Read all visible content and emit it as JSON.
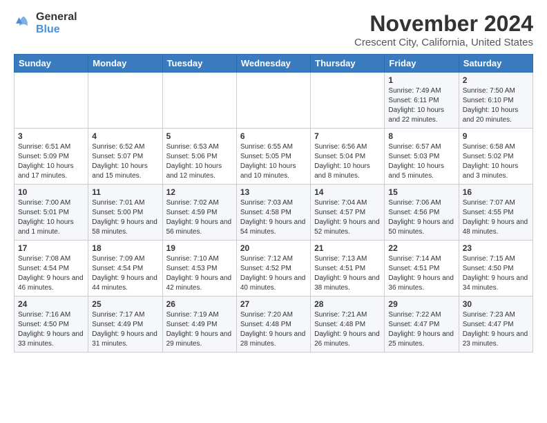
{
  "logo": {
    "line1": "General",
    "line2": "Blue"
  },
  "title": "November 2024",
  "subtitle": "Crescent City, California, United States",
  "days_of_week": [
    "Sunday",
    "Monday",
    "Tuesday",
    "Wednesday",
    "Thursday",
    "Friday",
    "Saturday"
  ],
  "weeks": [
    [
      {
        "day": "",
        "info": ""
      },
      {
        "day": "",
        "info": ""
      },
      {
        "day": "",
        "info": ""
      },
      {
        "day": "",
        "info": ""
      },
      {
        "day": "",
        "info": ""
      },
      {
        "day": "1",
        "info": "Sunrise: 7:49 AM\nSunset: 6:11 PM\nDaylight: 10 hours and 22 minutes."
      },
      {
        "day": "2",
        "info": "Sunrise: 7:50 AM\nSunset: 6:10 PM\nDaylight: 10 hours and 20 minutes."
      }
    ],
    [
      {
        "day": "3",
        "info": "Sunrise: 6:51 AM\nSunset: 5:09 PM\nDaylight: 10 hours and 17 minutes."
      },
      {
        "day": "4",
        "info": "Sunrise: 6:52 AM\nSunset: 5:07 PM\nDaylight: 10 hours and 15 minutes."
      },
      {
        "day": "5",
        "info": "Sunrise: 6:53 AM\nSunset: 5:06 PM\nDaylight: 10 hours and 12 minutes."
      },
      {
        "day": "6",
        "info": "Sunrise: 6:55 AM\nSunset: 5:05 PM\nDaylight: 10 hours and 10 minutes."
      },
      {
        "day": "7",
        "info": "Sunrise: 6:56 AM\nSunset: 5:04 PM\nDaylight: 10 hours and 8 minutes."
      },
      {
        "day": "8",
        "info": "Sunrise: 6:57 AM\nSunset: 5:03 PM\nDaylight: 10 hours and 5 minutes."
      },
      {
        "day": "9",
        "info": "Sunrise: 6:58 AM\nSunset: 5:02 PM\nDaylight: 10 hours and 3 minutes."
      }
    ],
    [
      {
        "day": "10",
        "info": "Sunrise: 7:00 AM\nSunset: 5:01 PM\nDaylight: 10 hours and 1 minute."
      },
      {
        "day": "11",
        "info": "Sunrise: 7:01 AM\nSunset: 5:00 PM\nDaylight: 9 hours and 58 minutes."
      },
      {
        "day": "12",
        "info": "Sunrise: 7:02 AM\nSunset: 4:59 PM\nDaylight: 9 hours and 56 minutes."
      },
      {
        "day": "13",
        "info": "Sunrise: 7:03 AM\nSunset: 4:58 PM\nDaylight: 9 hours and 54 minutes."
      },
      {
        "day": "14",
        "info": "Sunrise: 7:04 AM\nSunset: 4:57 PM\nDaylight: 9 hours and 52 minutes."
      },
      {
        "day": "15",
        "info": "Sunrise: 7:06 AM\nSunset: 4:56 PM\nDaylight: 9 hours and 50 minutes."
      },
      {
        "day": "16",
        "info": "Sunrise: 7:07 AM\nSunset: 4:55 PM\nDaylight: 9 hours and 48 minutes."
      }
    ],
    [
      {
        "day": "17",
        "info": "Sunrise: 7:08 AM\nSunset: 4:54 PM\nDaylight: 9 hours and 46 minutes."
      },
      {
        "day": "18",
        "info": "Sunrise: 7:09 AM\nSunset: 4:54 PM\nDaylight: 9 hours and 44 minutes."
      },
      {
        "day": "19",
        "info": "Sunrise: 7:10 AM\nSunset: 4:53 PM\nDaylight: 9 hours and 42 minutes."
      },
      {
        "day": "20",
        "info": "Sunrise: 7:12 AM\nSunset: 4:52 PM\nDaylight: 9 hours and 40 minutes."
      },
      {
        "day": "21",
        "info": "Sunrise: 7:13 AM\nSunset: 4:51 PM\nDaylight: 9 hours and 38 minutes."
      },
      {
        "day": "22",
        "info": "Sunrise: 7:14 AM\nSunset: 4:51 PM\nDaylight: 9 hours and 36 minutes."
      },
      {
        "day": "23",
        "info": "Sunrise: 7:15 AM\nSunset: 4:50 PM\nDaylight: 9 hours and 34 minutes."
      }
    ],
    [
      {
        "day": "24",
        "info": "Sunrise: 7:16 AM\nSunset: 4:50 PM\nDaylight: 9 hours and 33 minutes."
      },
      {
        "day": "25",
        "info": "Sunrise: 7:17 AM\nSunset: 4:49 PM\nDaylight: 9 hours and 31 minutes."
      },
      {
        "day": "26",
        "info": "Sunrise: 7:19 AM\nSunset: 4:49 PM\nDaylight: 9 hours and 29 minutes."
      },
      {
        "day": "27",
        "info": "Sunrise: 7:20 AM\nSunset: 4:48 PM\nDaylight: 9 hours and 28 minutes."
      },
      {
        "day": "28",
        "info": "Sunrise: 7:21 AM\nSunset: 4:48 PM\nDaylight: 9 hours and 26 minutes."
      },
      {
        "day": "29",
        "info": "Sunrise: 7:22 AM\nSunset: 4:47 PM\nDaylight: 9 hours and 25 minutes."
      },
      {
        "day": "30",
        "info": "Sunrise: 7:23 AM\nSunset: 4:47 PM\nDaylight: 9 hours and 23 minutes."
      }
    ]
  ]
}
